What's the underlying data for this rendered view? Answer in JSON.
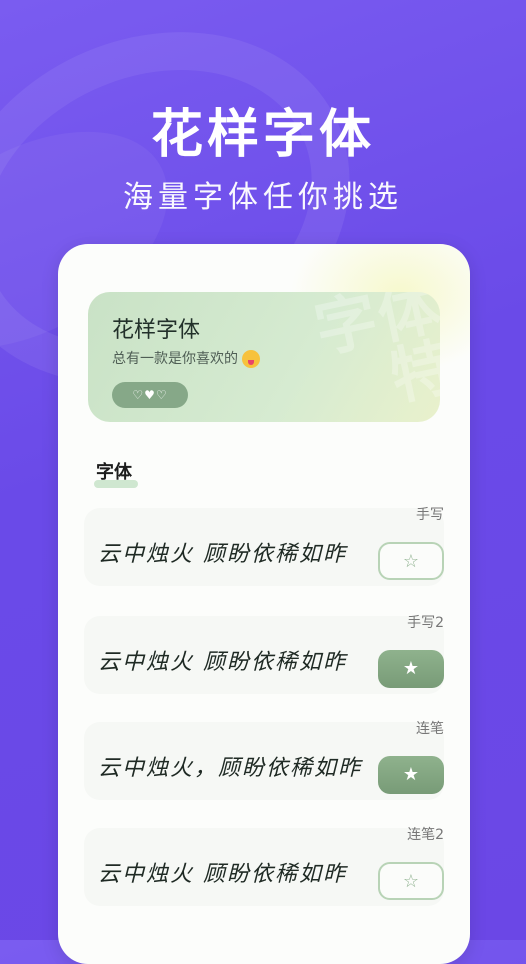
{
  "hero": {
    "title": "花样字体",
    "subtitle": "海量字体任你挑选"
  },
  "banner": {
    "title": "花样字体",
    "description": "总有一款是你喜欢的",
    "pill": "♡♥♡",
    "watermark": "字体 特"
  },
  "section": {
    "title": "字体"
  },
  "fonts": [
    {
      "sample": "云中烛火 顾盼依稀如昨",
      "tag": "手写",
      "favorited": false,
      "star": "☆"
    },
    {
      "sample": "云中烛火 顾盼依稀如昨",
      "tag": "手写2",
      "favorited": true,
      "star": "★"
    },
    {
      "sample": "云中烛火，顾盼依稀如昨",
      "tag": "连笔",
      "favorited": true,
      "star": "★"
    },
    {
      "sample": "云中烛火 顾盼依稀如昨",
      "tag": "连笔2",
      "favorited": false,
      "star": "☆"
    }
  ],
  "colors": {
    "background": "#6b47e6",
    "accent_green": "#86a888"
  }
}
